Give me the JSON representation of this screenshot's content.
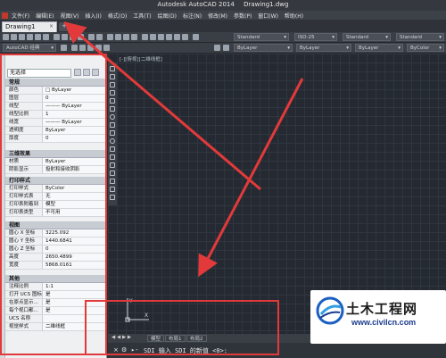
{
  "window": {
    "app_title": "Autodesk AutoCAD 2014",
    "file_name": "Drawing1.dwg"
  },
  "menu": {
    "items": [
      "文件(F)",
      "编辑(E)",
      "视图(V)",
      "插入(I)",
      "格式(O)",
      "工具(T)",
      "绘图(D)",
      "标注(N)",
      "修改(M)",
      "参数(P)",
      "窗口(W)",
      "帮助(H)"
    ]
  },
  "tabs": {
    "document_tab": "Drawing1",
    "close_glyph": "×",
    "new_tab_glyph": "+"
  },
  "toolbar": {
    "workspace": "AutoCAD 经典",
    "text_style": "Standard",
    "dim_style": "ISO-25",
    "table_style": "Standard",
    "multileader_style": "Standard",
    "layer_color": "ByLayer",
    "layer_linetype": "ByLayer",
    "layer_lineweight": "ByLayer",
    "plot_style": "ByColor"
  },
  "palette": {
    "selection": "无选择",
    "sections": [
      {
        "title": "常规",
        "rows": [
          {
            "k": "颜色",
            "v": "□ ByLayer"
          },
          {
            "k": "图层",
            "v": "0"
          },
          {
            "k": "线型",
            "v": "——— ByLayer"
          },
          {
            "k": "线型比例",
            "v": "1"
          },
          {
            "k": "线宽",
            "v": "——— ByLayer"
          },
          {
            "k": "透明度",
            "v": "ByLayer"
          },
          {
            "k": "厚度",
            "v": "0"
          }
        ]
      },
      {
        "title": "三维效果",
        "rows": [
          {
            "k": "材质",
            "v": "ByLayer"
          },
          {
            "k": "阴影显示",
            "v": "投射和接收阴影"
          }
        ]
      },
      {
        "title": "打印样式",
        "rows": [
          {
            "k": "打印样式",
            "v": "ByColor"
          },
          {
            "k": "打印样式表",
            "v": "无"
          },
          {
            "k": "打印表附着到",
            "v": "模型"
          },
          {
            "k": "打印表类型",
            "v": "不可用"
          }
        ]
      },
      {
        "title": "视图",
        "rows": [
          {
            "k": "圆心 X 坐标",
            "v": "3225.092"
          },
          {
            "k": "圆心 Y 坐标",
            "v": "1440.6841"
          },
          {
            "k": "圆心 Z 坐标",
            "v": "0"
          },
          {
            "k": "高度",
            "v": "2650.4899"
          },
          {
            "k": "宽度",
            "v": "5868.0161"
          }
        ]
      },
      {
        "title": "其他",
        "rows": [
          {
            "k": "注释比例",
            "v": "1:1"
          },
          {
            "k": "打开 UCS 图标",
            "v": "是"
          },
          {
            "k": "在原点显示...",
            "v": "是"
          },
          {
            "k": "每个视口都...",
            "v": "是"
          },
          {
            "k": "UCS 名称",
            "v": ""
          },
          {
            "k": "视觉样式",
            "v": "二维线框"
          }
        ]
      }
    ]
  },
  "canvas": {
    "view_label": "[-][俯视][二维线框]",
    "ucs_x": "X",
    "ucs_y": "Y"
  },
  "layout_tabs": {
    "nav": "◀ ◀ ▶ ▶",
    "model": "模型",
    "layout1": "布局1",
    "layout2": "布局2"
  },
  "command": {
    "close": "×",
    "wrench": "⚙",
    "prompt": "▸-",
    "text": "SDI 输入 SDI 的新值 <0>:"
  },
  "watermark": {
    "brand": "土木工程网",
    "url": "www.civilcn.com"
  },
  "colors": {
    "annotation": "#e23a3a",
    "canvas_bg": "#252a32"
  }
}
